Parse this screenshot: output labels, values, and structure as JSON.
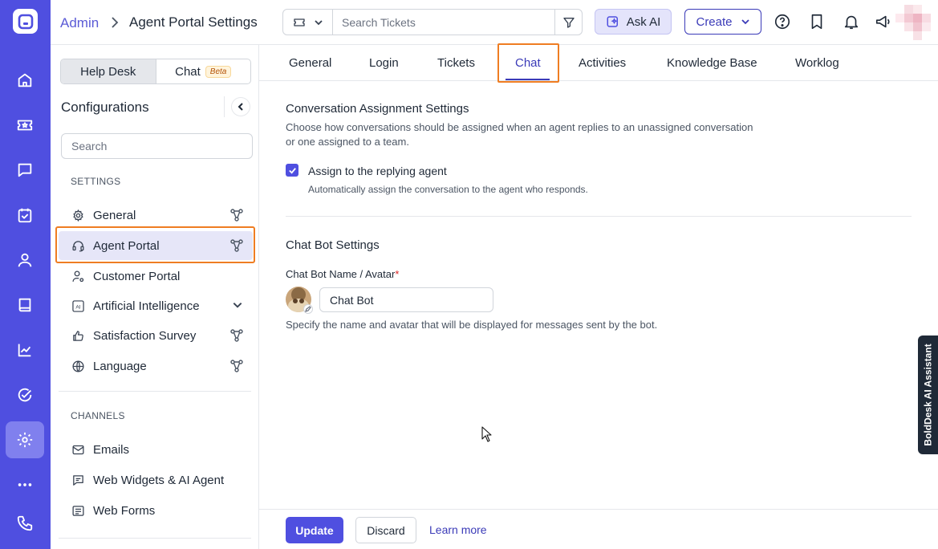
{
  "header": {
    "breadcrumb_root": "Admin",
    "page_title": "Agent Portal Settings",
    "search_placeholder": "Search Tickets",
    "ask_ai_label": "Ask AI",
    "create_label": "Create"
  },
  "sidebar": {
    "segments": [
      {
        "label": "Help Desk",
        "active": true
      },
      {
        "label": "Chat",
        "badge": "Beta",
        "active": false
      }
    ],
    "title": "Configurations",
    "search_placeholder": "Search",
    "settings_label": "SETTINGS",
    "settings_items": [
      {
        "label": "General",
        "icon": "gear-icon"
      },
      {
        "label": "Agent Portal",
        "icon": "headset-icon",
        "active": true
      },
      {
        "label": "Customer Portal",
        "icon": "user-gear-icon"
      },
      {
        "label": "Artificial Intelligence",
        "icon": "ai-icon"
      },
      {
        "label": "Satisfaction Survey",
        "icon": "thumbs-up-icon"
      },
      {
        "label": "Language",
        "icon": "globe-icon"
      }
    ],
    "channels_label": "CHANNELS",
    "channel_items": [
      {
        "label": "Emails",
        "icon": "mail-icon"
      },
      {
        "label": "Web Widgets & AI Agent",
        "icon": "chat-widget-icon"
      },
      {
        "label": "Web Forms",
        "icon": "form-icon"
      }
    ]
  },
  "tabs": [
    {
      "label": "General"
    },
    {
      "label": "Login"
    },
    {
      "label": "Tickets"
    },
    {
      "label": "Chat",
      "active": true
    },
    {
      "label": "Activities"
    },
    {
      "label": "Knowledge Base"
    },
    {
      "label": "Worklog"
    }
  ],
  "content": {
    "assignment_title": "Conversation Assignment Settings",
    "assignment_desc_line1": "Choose how conversations should be assigned when an agent replies to an unassigned conversation",
    "assignment_desc_line2": "or one assigned to a team.",
    "assign_checkbox_label": "Assign to the replying agent",
    "assign_checkbox_checked": true,
    "assign_checkbox_desc": "Automatically assign the conversation to the agent who responds.",
    "bot_title": "Chat Bot Settings",
    "bot_field_label": "Chat Bot Name / Avatar",
    "bot_required_mark": "*",
    "bot_name_value": "Chat Bot",
    "bot_help": "Specify the name and avatar that will be displayed for messages sent by the bot."
  },
  "footer": {
    "update_label": "Update",
    "discard_label": "Discard",
    "learn_more_label": "Learn more"
  },
  "assistant_tab_label": "BoldDesk AI Assistant",
  "colors": {
    "brand": "#4f4fe0",
    "accent_text": "#3b3bb8",
    "highlight_ring": "#ef7d22"
  }
}
